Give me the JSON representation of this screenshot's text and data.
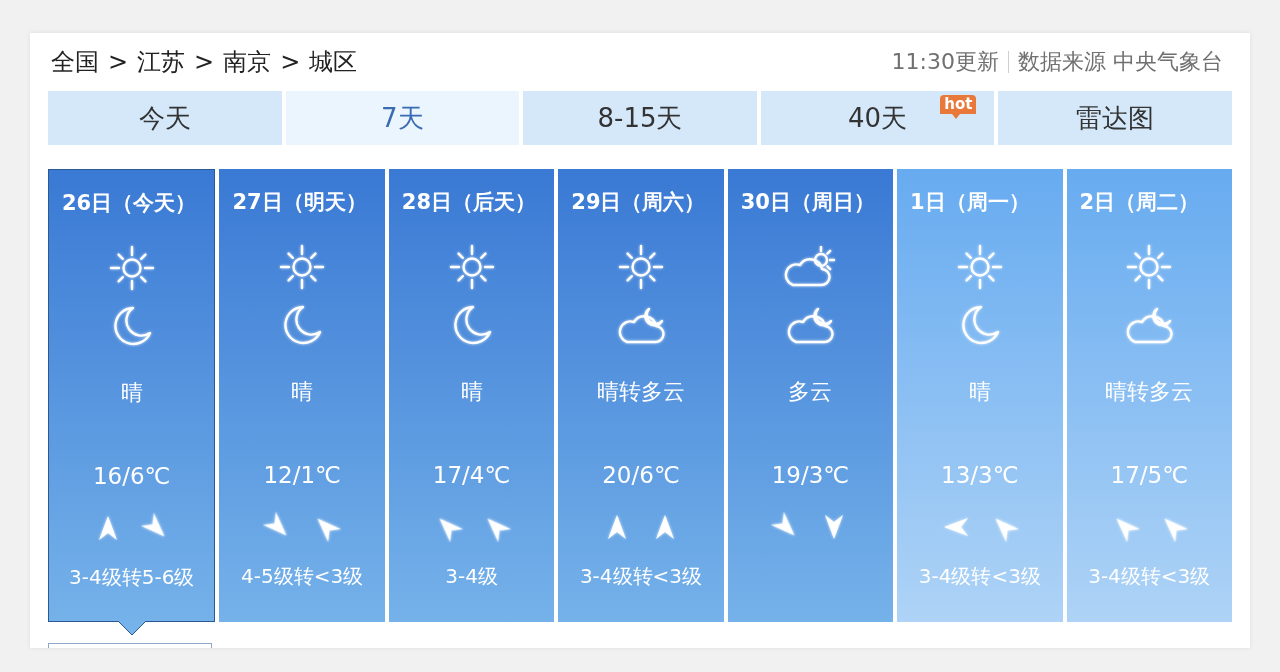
{
  "breadcrumb": {
    "items": [
      "全国",
      "江苏",
      "南京",
      "城区"
    ],
    "separator": ">"
  },
  "meta": {
    "update_time": "11:30更新",
    "source": "数据来源 中央气象台"
  },
  "tabs": [
    {
      "label": "今天",
      "selected": false
    },
    {
      "label": "7天",
      "selected": true
    },
    {
      "label": "8-15天",
      "selected": false
    },
    {
      "label": "40天",
      "selected": false,
      "badge": "hot"
    },
    {
      "label": "雷达图",
      "selected": false
    }
  ],
  "days": [
    {
      "date": "26日（今天）",
      "selected": true,
      "pale": false,
      "icons": [
        {
          "kind": "sun"
        },
        {
          "kind": "moon"
        }
      ],
      "weather": "晴",
      "temperature": "16/6℃",
      "arrows": [
        {
          "kind": "north"
        },
        {
          "kind": "southeast"
        }
      ],
      "wind": "3-4级转5-6级"
    },
    {
      "date": "27日（明天）",
      "selected": false,
      "pale": false,
      "icons": [
        {
          "kind": "sun"
        },
        {
          "kind": "moon"
        }
      ],
      "weather": "晴",
      "temperature": "12/1℃",
      "arrows": [
        {
          "kind": "southeast"
        },
        {
          "kind": "northwest"
        }
      ],
      "wind": "4-5级转<3级"
    },
    {
      "date": "28日（后天）",
      "selected": false,
      "pale": false,
      "icons": [
        {
          "kind": "sun"
        },
        {
          "kind": "moon"
        }
      ],
      "weather": "晴",
      "temperature": "17/4℃",
      "arrows": [
        {
          "kind": "northwest"
        },
        {
          "kind": "northwest"
        }
      ],
      "wind": "3-4级"
    },
    {
      "date": "29日（周六）",
      "selected": false,
      "pale": false,
      "icons": [
        {
          "kind": "sun"
        },
        {
          "kind": "cloudmoon"
        }
      ],
      "weather": "晴转多云",
      "temperature": "20/6℃",
      "arrows": [
        {
          "kind": "north"
        },
        {
          "kind": "north"
        }
      ],
      "wind": "3-4级转<3级"
    },
    {
      "date": "30日（周日）",
      "selected": false,
      "pale": false,
      "icons": [
        {
          "kind": "cloudsun"
        },
        {
          "kind": "cloudmoon"
        }
      ],
      "weather": "多云",
      "temperature": "19/3℃",
      "arrows": [
        {
          "kind": "southeast"
        },
        {
          "kind": "south"
        }
      ]
    },
    {
      "date": "1日（周一）",
      "selected": false,
      "pale": true,
      "icons": [
        {
          "kind": "sun"
        },
        {
          "kind": "moon"
        }
      ],
      "weather": "晴",
      "temperature": "13/3℃",
      "arrows": [
        {
          "kind": "west"
        },
        {
          "kind": "northwest"
        }
      ],
      "wind": "3-4级转<3级"
    },
    {
      "date": "2日（周二）",
      "selected": false,
      "pale": true,
      "icons": [
        {
          "kind": "sun"
        },
        {
          "kind": "cloudmoon"
        }
      ],
      "weather": "晴转多云",
      "temperature": "17/5℃",
      "arrows": [
        {
          "kind": "northwest"
        },
        {
          "kind": "northwest"
        }
      ],
      "wind": "3-4级转<3级"
    }
  ]
}
